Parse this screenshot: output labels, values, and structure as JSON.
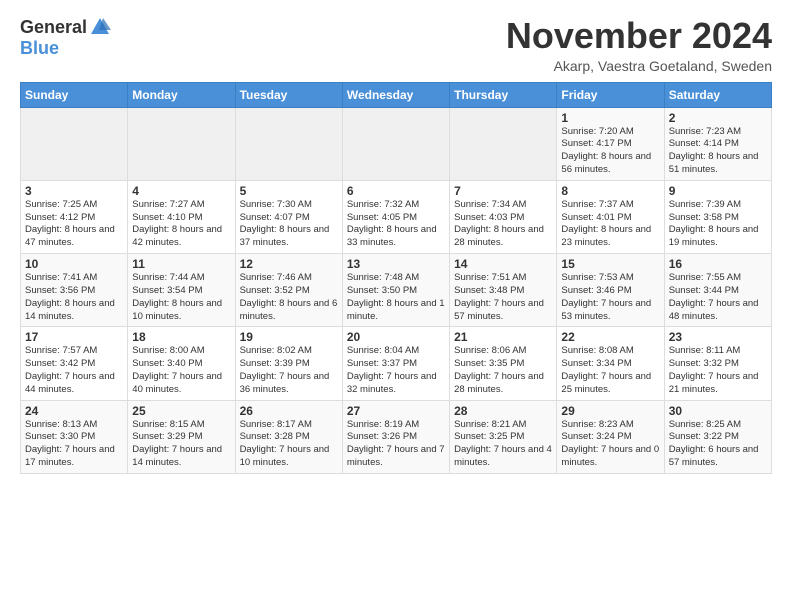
{
  "logo": {
    "general": "General",
    "blue": "Blue"
  },
  "header": {
    "title": "November 2024",
    "subtitle": "Akarp, Vaestra Goetaland, Sweden"
  },
  "weekdays": [
    "Sunday",
    "Monday",
    "Tuesday",
    "Wednesday",
    "Thursday",
    "Friday",
    "Saturday"
  ],
  "weeks": [
    [
      {
        "day": "",
        "info": ""
      },
      {
        "day": "",
        "info": ""
      },
      {
        "day": "",
        "info": ""
      },
      {
        "day": "",
        "info": ""
      },
      {
        "day": "",
        "info": ""
      },
      {
        "day": "1",
        "info": "Sunrise: 7:20 AM\nSunset: 4:17 PM\nDaylight: 8 hours\nand 56 minutes."
      },
      {
        "day": "2",
        "info": "Sunrise: 7:23 AM\nSunset: 4:14 PM\nDaylight: 8 hours\nand 51 minutes."
      }
    ],
    [
      {
        "day": "3",
        "info": "Sunrise: 7:25 AM\nSunset: 4:12 PM\nDaylight: 8 hours\nand 47 minutes."
      },
      {
        "day": "4",
        "info": "Sunrise: 7:27 AM\nSunset: 4:10 PM\nDaylight: 8 hours\nand 42 minutes."
      },
      {
        "day": "5",
        "info": "Sunrise: 7:30 AM\nSunset: 4:07 PM\nDaylight: 8 hours\nand 37 minutes."
      },
      {
        "day": "6",
        "info": "Sunrise: 7:32 AM\nSunset: 4:05 PM\nDaylight: 8 hours\nand 33 minutes."
      },
      {
        "day": "7",
        "info": "Sunrise: 7:34 AM\nSunset: 4:03 PM\nDaylight: 8 hours\nand 28 minutes."
      },
      {
        "day": "8",
        "info": "Sunrise: 7:37 AM\nSunset: 4:01 PM\nDaylight: 8 hours\nand 23 minutes."
      },
      {
        "day": "9",
        "info": "Sunrise: 7:39 AM\nSunset: 3:58 PM\nDaylight: 8 hours\nand 19 minutes."
      }
    ],
    [
      {
        "day": "10",
        "info": "Sunrise: 7:41 AM\nSunset: 3:56 PM\nDaylight: 8 hours\nand 14 minutes."
      },
      {
        "day": "11",
        "info": "Sunrise: 7:44 AM\nSunset: 3:54 PM\nDaylight: 8 hours\nand 10 minutes."
      },
      {
        "day": "12",
        "info": "Sunrise: 7:46 AM\nSunset: 3:52 PM\nDaylight: 8 hours\nand 6 minutes."
      },
      {
        "day": "13",
        "info": "Sunrise: 7:48 AM\nSunset: 3:50 PM\nDaylight: 8 hours\nand 1 minute."
      },
      {
        "day": "14",
        "info": "Sunrise: 7:51 AM\nSunset: 3:48 PM\nDaylight: 7 hours\nand 57 minutes."
      },
      {
        "day": "15",
        "info": "Sunrise: 7:53 AM\nSunset: 3:46 PM\nDaylight: 7 hours\nand 53 minutes."
      },
      {
        "day": "16",
        "info": "Sunrise: 7:55 AM\nSunset: 3:44 PM\nDaylight: 7 hours\nand 48 minutes."
      }
    ],
    [
      {
        "day": "17",
        "info": "Sunrise: 7:57 AM\nSunset: 3:42 PM\nDaylight: 7 hours\nand 44 minutes."
      },
      {
        "day": "18",
        "info": "Sunrise: 8:00 AM\nSunset: 3:40 PM\nDaylight: 7 hours\nand 40 minutes."
      },
      {
        "day": "19",
        "info": "Sunrise: 8:02 AM\nSunset: 3:39 PM\nDaylight: 7 hours\nand 36 minutes."
      },
      {
        "day": "20",
        "info": "Sunrise: 8:04 AM\nSunset: 3:37 PM\nDaylight: 7 hours\nand 32 minutes."
      },
      {
        "day": "21",
        "info": "Sunrise: 8:06 AM\nSunset: 3:35 PM\nDaylight: 7 hours\nand 28 minutes."
      },
      {
        "day": "22",
        "info": "Sunrise: 8:08 AM\nSunset: 3:34 PM\nDaylight: 7 hours\nand 25 minutes."
      },
      {
        "day": "23",
        "info": "Sunrise: 8:11 AM\nSunset: 3:32 PM\nDaylight: 7 hours\nand 21 minutes."
      }
    ],
    [
      {
        "day": "24",
        "info": "Sunrise: 8:13 AM\nSunset: 3:30 PM\nDaylight: 7 hours\nand 17 minutes."
      },
      {
        "day": "25",
        "info": "Sunrise: 8:15 AM\nSunset: 3:29 PM\nDaylight: 7 hours\nand 14 minutes."
      },
      {
        "day": "26",
        "info": "Sunrise: 8:17 AM\nSunset: 3:28 PM\nDaylight: 7 hours\nand 10 minutes."
      },
      {
        "day": "27",
        "info": "Sunrise: 8:19 AM\nSunset: 3:26 PM\nDaylight: 7 hours\nand 7 minutes."
      },
      {
        "day": "28",
        "info": "Sunrise: 8:21 AM\nSunset: 3:25 PM\nDaylight: 7 hours\nand 4 minutes."
      },
      {
        "day": "29",
        "info": "Sunrise: 8:23 AM\nSunset: 3:24 PM\nDaylight: 7 hours\nand 0 minutes."
      },
      {
        "day": "30",
        "info": "Sunrise: 8:25 AM\nSunset: 3:22 PM\nDaylight: 6 hours\nand 57 minutes."
      }
    ]
  ]
}
